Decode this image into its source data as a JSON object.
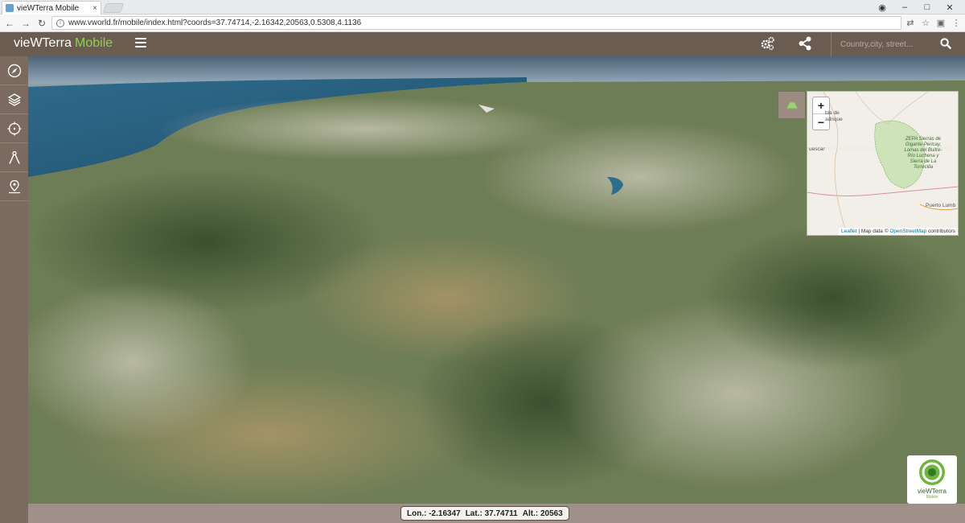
{
  "browser": {
    "tab_title": "vieWTerra Mobile",
    "tab_close": "×",
    "url": "www.vworld.fr/mobile/index.html?coords=37.74714,-2.16342,20563,0.5308,4.1136",
    "window_controls": [
      "–",
      "□",
      "✕"
    ]
  },
  "header": {
    "brand_main": "vieWTerra",
    "brand_accent": "Mobile",
    "search_placeholder": "Country,city, street...",
    "colors": {
      "bar": "#6b5c52",
      "accent": "#8ed14a"
    }
  },
  "sidebar": {
    "items": [
      {
        "icon": "compass-icon"
      },
      {
        "icon": "layers-icon"
      },
      {
        "icon": "crosshair-icon"
      },
      {
        "icon": "measure-icon"
      },
      {
        "icon": "location-pin-icon"
      }
    ]
  },
  "minimap": {
    "zoom_in": "+",
    "zoom_out": "−",
    "labels": {
      "place1": "bla de",
      "place2": "adrique",
      "place3": "uescar",
      "place4": "Puerto Lumb",
      "zepa": "ZEPA Sierras de Gigante-Pericay, Lomas del Buitre-Río Luchena y Sierra de La Torrecilla"
    },
    "attribution": {
      "leaflet": "Leaflet",
      "middle": " | Map data © ",
      "osm": "OpenStreetMap",
      "tail": " contributors"
    }
  },
  "logo": {
    "name": "vieWTerra",
    "sub": "Mobile"
  },
  "status": {
    "lon": "Lon.: -2.16347",
    "lat": "Lat.: 37.74711",
    "alt": "Alt.: 20563"
  }
}
